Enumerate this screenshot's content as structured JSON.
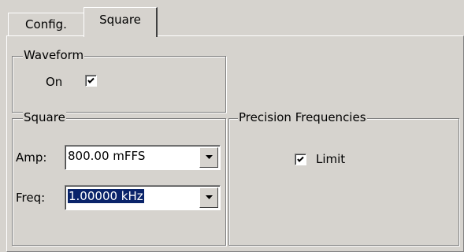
{
  "tabs": [
    {
      "label": "Config."
    },
    {
      "label": "Square"
    }
  ],
  "waveform": {
    "title": "Waveform",
    "on_label": "On",
    "on_checked": true
  },
  "square": {
    "title": "Square",
    "amp_label": "Amp:",
    "amp_value": "800.00 mFFS",
    "freq_label": "Freq:",
    "freq_value": "1.00000 kHz"
  },
  "precision": {
    "title": "Precision Frequencies",
    "limit_label": "Limit",
    "limit_checked": true
  },
  "colors": {
    "face": "#d6d3ce",
    "selection": "#0a246a"
  },
  "icons": {
    "check": "check-mark-icon",
    "dropdown": "chevron-down-icon"
  }
}
